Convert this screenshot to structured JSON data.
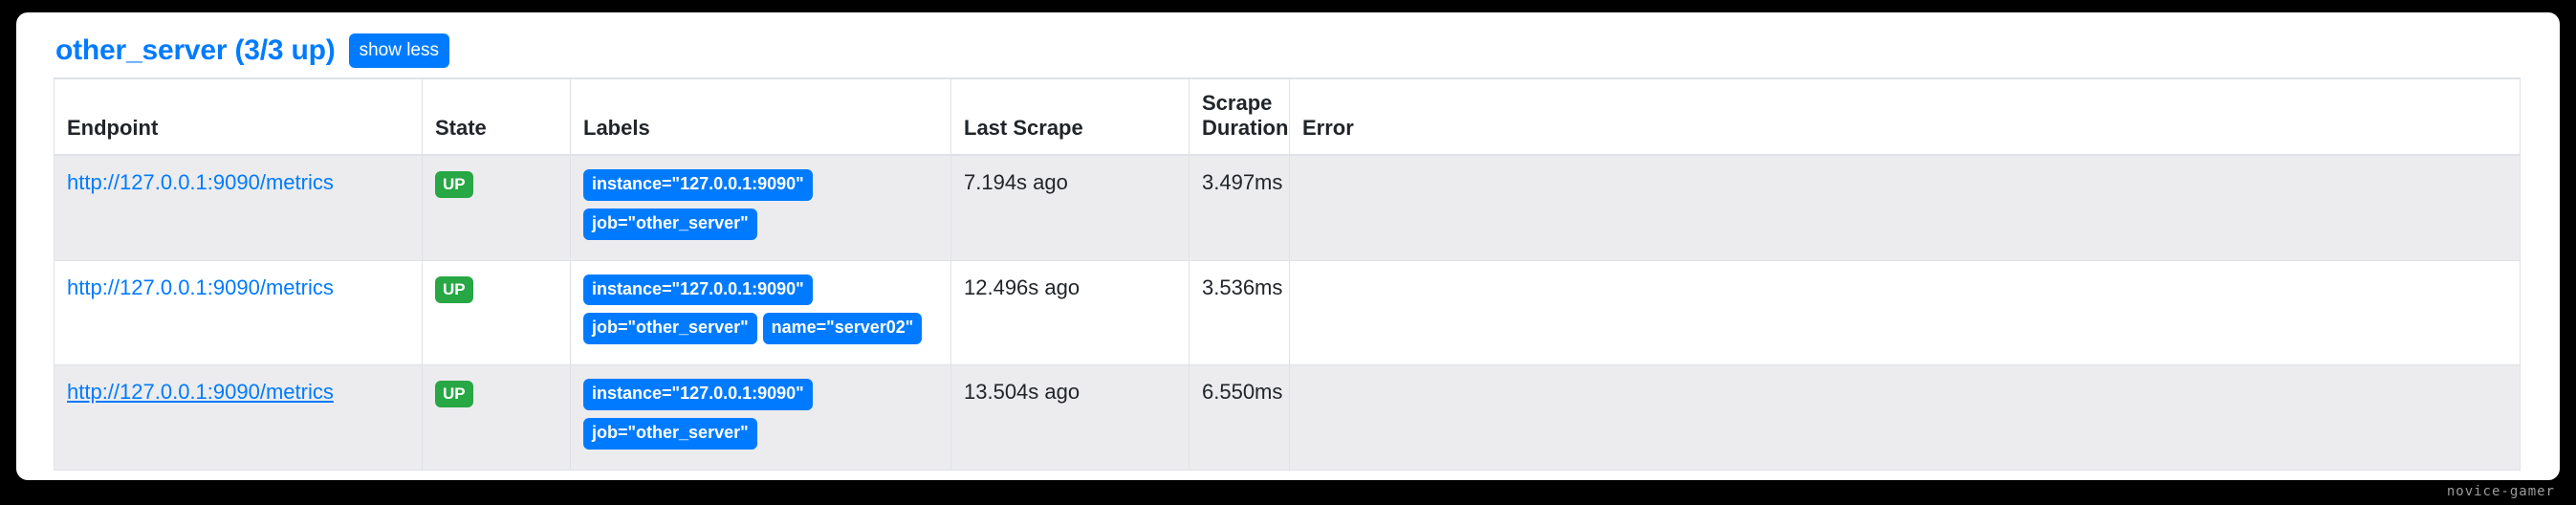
{
  "colors": {
    "brand_blue": "#007bff",
    "state_up_green": "#28a745",
    "card_background": "#ffffff",
    "page_background": "#000000",
    "row_striped": "#ececee",
    "border": "#dee2e6",
    "text": "#212529"
  },
  "header": {
    "job_title": "other_server (3/3 up)",
    "show_less_label": "show less"
  },
  "table": {
    "columns": [
      {
        "key": "endpoint",
        "label": "Endpoint"
      },
      {
        "key": "state",
        "label": "State"
      },
      {
        "key": "labels",
        "label": "Labels"
      },
      {
        "key": "last_scrape",
        "label": "Last Scrape"
      },
      {
        "key": "scrape_duration",
        "label": "Scrape Duration"
      },
      {
        "key": "error",
        "label": "Error"
      }
    ],
    "rows": [
      {
        "endpoint": "http://127.0.0.1:9090/metrics",
        "endpoint_hovered": false,
        "state": "UP",
        "labels": [
          "instance=\"127.0.0.1:9090\"",
          "job=\"other_server\""
        ],
        "last_scrape": "7.194s ago",
        "scrape_duration": "3.497ms",
        "error": ""
      },
      {
        "endpoint": "http://127.0.0.1:9090/metrics",
        "endpoint_hovered": false,
        "state": "UP",
        "labels": [
          "instance=\"127.0.0.1:9090\"",
          "job=\"other_server\"",
          "name=\"server02\""
        ],
        "last_scrape": "12.496s ago",
        "scrape_duration": "3.536ms",
        "error": ""
      },
      {
        "endpoint": "http://127.0.0.1:9090/metrics",
        "endpoint_hovered": true,
        "state": "UP",
        "labels": [
          "instance=\"127.0.0.1:9090\"",
          "job=\"other_server\""
        ],
        "last_scrape": "13.504s ago",
        "scrape_duration": "6.550ms",
        "error": ""
      }
    ]
  },
  "watermark": {
    "text": "novice-gamer"
  }
}
